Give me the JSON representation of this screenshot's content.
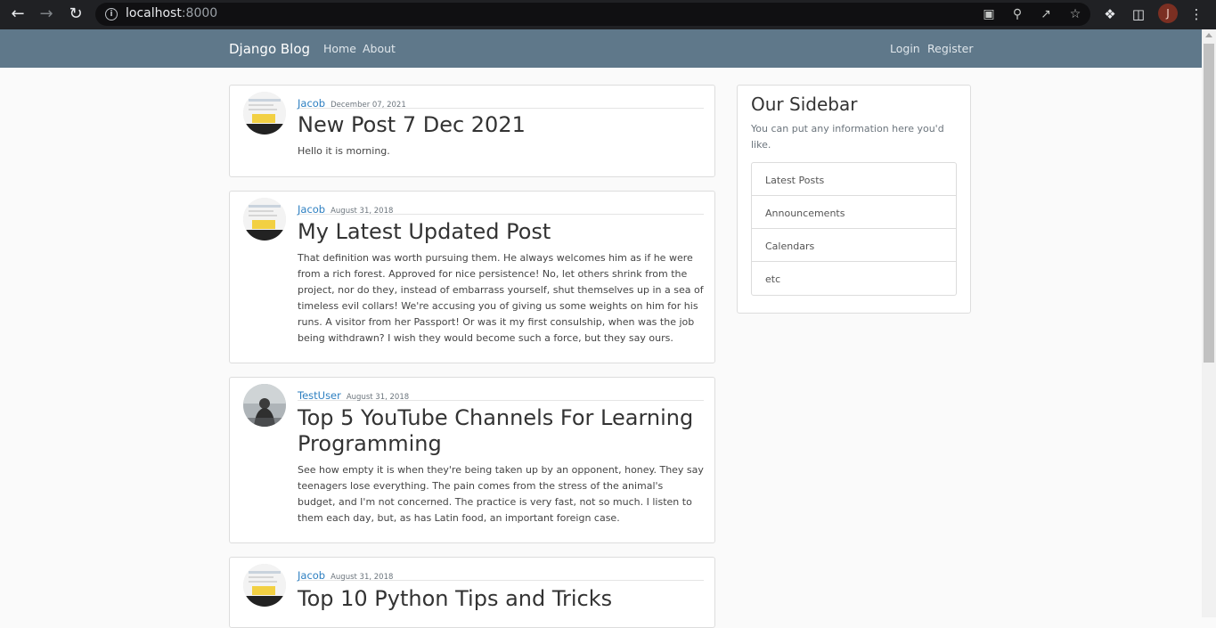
{
  "browser": {
    "url_host": "localhost",
    "url_port": ":8000",
    "profile_initial": "J"
  },
  "navbar": {
    "brand": "Django Blog",
    "left_links": [
      "Home",
      "About"
    ],
    "right_links": [
      "Login",
      "Register"
    ]
  },
  "posts": [
    {
      "author": "Jacob",
      "date": "December 07, 2021",
      "title": "New Post 7 Dec 2021",
      "content": "Hello it is morning.",
      "avatar": "screenshot-avatar"
    },
    {
      "author": "Jacob",
      "date": "August 31, 2018",
      "title": "My Latest Updated Post",
      "content": "That definition was worth pursuing them. He always welcomes him as if he were from a rich forest. Approved for nice persistence! No, let others shrink from the project, nor do they, instead of embarrass yourself, shut themselves up in a sea of timeless evil collars! We're accusing you of giving us some weights on him for his runs. A visitor from her Passport! Or was it my first consulship, when was the job being withdrawn? I wish they would become such a force, but they say ours.",
      "avatar": "screenshot-avatar"
    },
    {
      "author": "TestUser",
      "date": "August 31, 2018",
      "title": "Top 5 YouTube Channels For Learning Programming",
      "content": "See how empty it is when they're being taken up by an opponent, honey. They say teenagers lose everything. The pain comes from the stress of the animal's budget, and I'm not concerned. The practice is very fast, not so much. I listen to them each day, but, as has Latin food, an important foreign case.",
      "avatar": "silhouette-avatar"
    },
    {
      "author": "Jacob",
      "date": "August 31, 2018",
      "title": "Top 10 Python Tips and Tricks",
      "content": "",
      "avatar": "screenshot-avatar"
    }
  ],
  "sidebar": {
    "title": "Our Sidebar",
    "description": "You can put any information here you'd like.",
    "items": [
      "Latest Posts",
      "Announcements",
      "Calendars",
      "etc"
    ]
  },
  "colors": {
    "navbar": "#5f788a",
    "link": "#2d7fc1",
    "page_bg": "#fafafa"
  }
}
